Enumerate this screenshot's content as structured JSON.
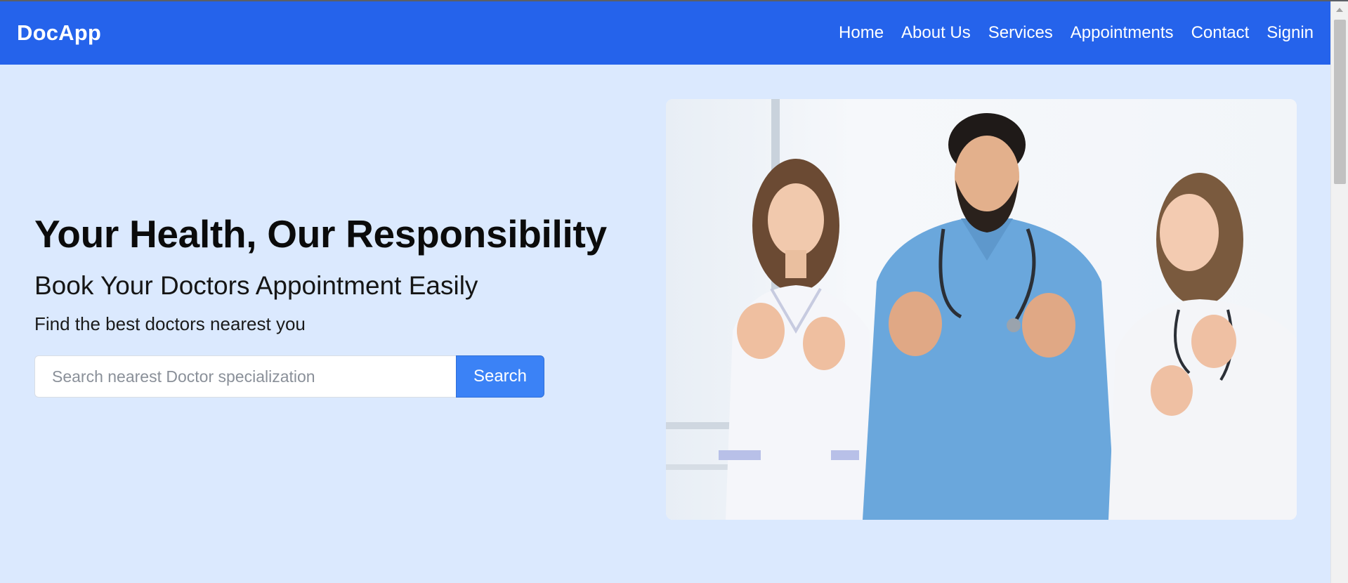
{
  "navbar": {
    "brand": "DocApp",
    "links": [
      "Home",
      "About Us",
      "Services",
      "Appointments",
      "Contact",
      "Signin"
    ]
  },
  "hero": {
    "title": "Your Health, Our Responsibility",
    "subtitle": "Book Your Doctors Appointment Easily",
    "tagline": "Find the best doctors nearest you",
    "search": {
      "placeholder": "Search nearest Doctor specialization",
      "value": "",
      "button_label": "Search"
    },
    "image": {
      "depicts": "three doctors giving thumbs up"
    }
  },
  "colors": {
    "navbar": "#2563eb",
    "page_background": "#dbe9fe",
    "search_button": "#3b82f6",
    "text": "#0b0b0b"
  }
}
